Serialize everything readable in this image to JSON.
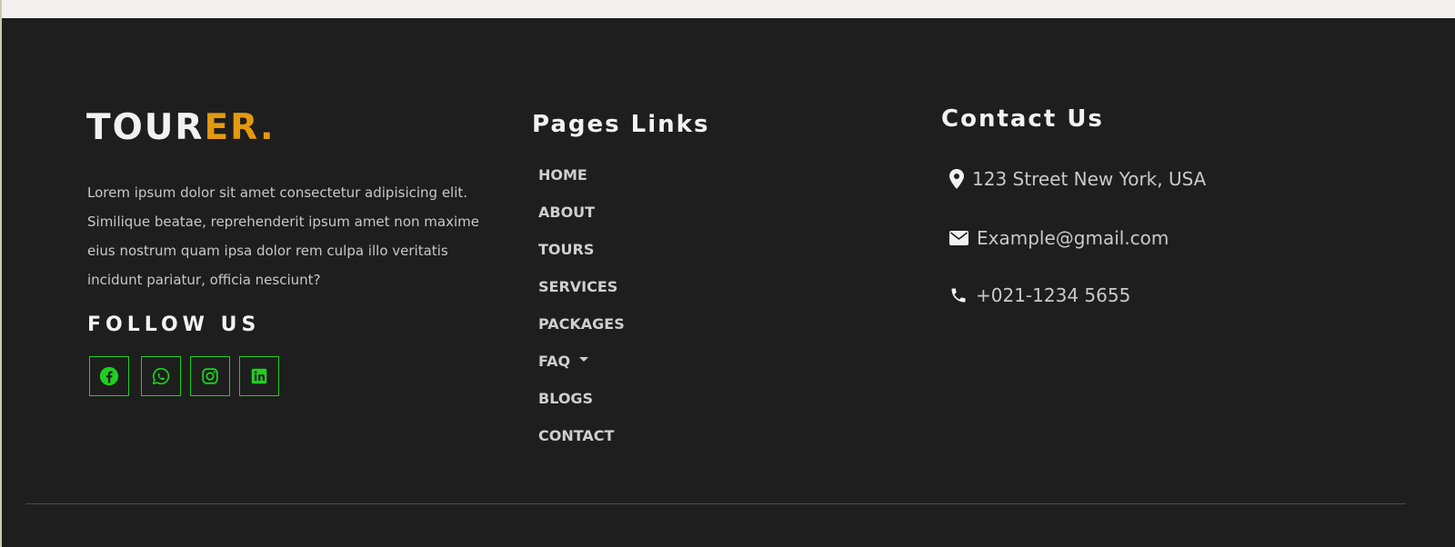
{
  "brand": {
    "main": "TOUR",
    "accent": "ER.",
    "accent_color": "#e39a10"
  },
  "about": {
    "text": "Lorem ipsum dolor sit amet consectetur adipisicing elit. Similique beatae, reprehenderit ipsum amet non maxime eius nostrum quam ipsa dolor rem culpa illo veritatis incidunt pariatur, officia nesciunt?"
  },
  "follow": {
    "title": "FOLLOW US",
    "icon_color": "#1fd01f",
    "items": [
      {
        "icon": "facebook-icon"
      },
      {
        "icon": "whatsapp-icon"
      },
      {
        "icon": "instagram-icon"
      },
      {
        "icon": "linkedin-icon"
      }
    ]
  },
  "links": {
    "title": "Pages Links",
    "items": [
      {
        "label": "HOME"
      },
      {
        "label": "ABOUT"
      },
      {
        "label": "TOURS"
      },
      {
        "label": "SERVICES"
      },
      {
        "label": "PACKAGES"
      },
      {
        "label": "FAQ",
        "has_dropdown": true
      },
      {
        "label": "BLOGS"
      },
      {
        "label": "CONTACT"
      }
    ]
  },
  "contact": {
    "title": "Contact Us",
    "items": [
      {
        "icon": "map-marker-icon",
        "text": "123 Street New York, USA"
      },
      {
        "icon": "envelope-icon",
        "text": "Example@gmail.com"
      },
      {
        "icon": "phone-icon",
        "text": "+021-1234 5655"
      }
    ]
  },
  "colors": {
    "footer_bg": "#1e1e1e",
    "text": "#c8c8c8",
    "heading": "#f2f2f2"
  }
}
